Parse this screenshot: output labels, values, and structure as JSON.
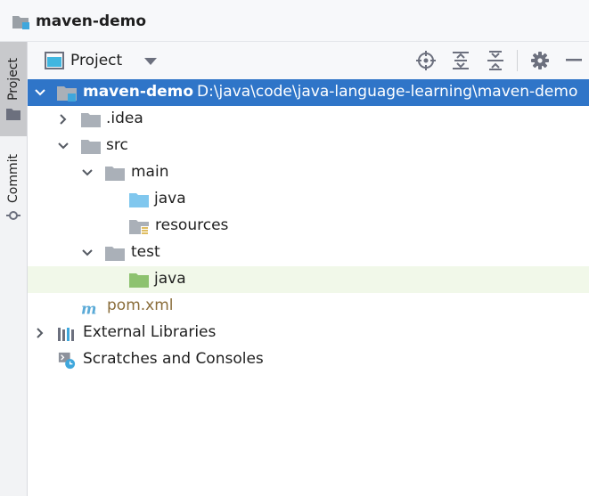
{
  "window": {
    "title": "maven-demo"
  },
  "sidebar": {
    "tabs": [
      {
        "label": "Project",
        "active": true
      },
      {
        "label": "Commit",
        "active": false
      }
    ]
  },
  "toolwindow": {
    "title": "Project"
  },
  "tree": {
    "root": {
      "name": "maven-demo",
      "path": "D:\\java\\code\\java-language-learning\\maven-demo"
    },
    "idea": ".idea",
    "src": "src",
    "main": "main",
    "main_java": "java",
    "resources": "resources",
    "test": "test",
    "test_java": "java",
    "pom": "pom.xml",
    "ext_libs": "External Libraries",
    "scratches": "Scratches and Consoles"
  },
  "colors": {
    "selection": "#2f75c8",
    "hover": "#f1f8e9",
    "source_folder": "#80c7ee",
    "test_folder": "#8dc26f",
    "plain_folder": "#aab0b8"
  }
}
